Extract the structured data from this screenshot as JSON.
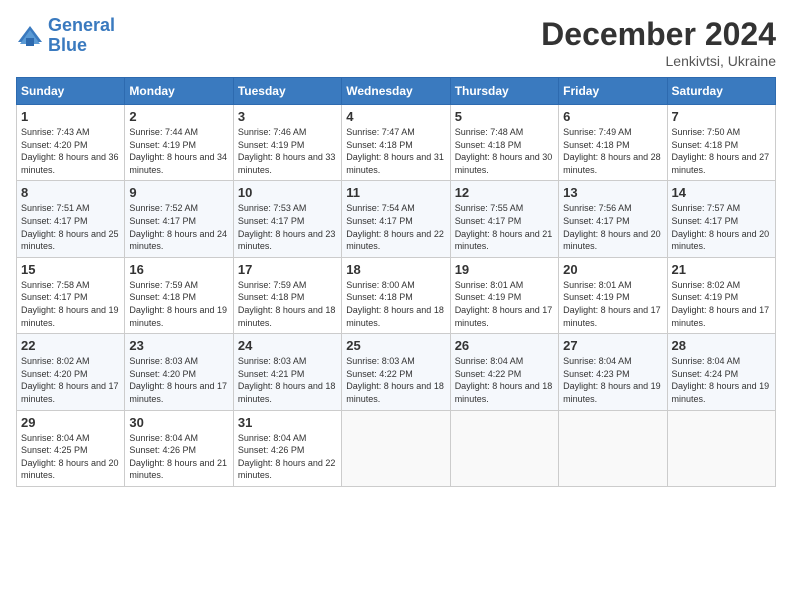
{
  "header": {
    "logo_line1": "General",
    "logo_line2": "Blue",
    "month": "December 2024",
    "location": "Lenkivtsi, Ukraine"
  },
  "days_of_week": [
    "Sunday",
    "Monday",
    "Tuesday",
    "Wednesday",
    "Thursday",
    "Friday",
    "Saturday"
  ],
  "weeks": [
    [
      {
        "num": "1",
        "rise": "7:43 AM",
        "set": "4:20 PM",
        "hours": "8 hours and 36 minutes."
      },
      {
        "num": "2",
        "rise": "7:44 AM",
        "set": "4:19 PM",
        "hours": "8 hours and 34 minutes."
      },
      {
        "num": "3",
        "rise": "7:46 AM",
        "set": "4:19 PM",
        "hours": "8 hours and 33 minutes."
      },
      {
        "num": "4",
        "rise": "7:47 AM",
        "set": "4:18 PM",
        "hours": "8 hours and 31 minutes."
      },
      {
        "num": "5",
        "rise": "7:48 AM",
        "set": "4:18 PM",
        "hours": "8 hours and 30 minutes."
      },
      {
        "num": "6",
        "rise": "7:49 AM",
        "set": "4:18 PM",
        "hours": "8 hours and 28 minutes."
      },
      {
        "num": "7",
        "rise": "7:50 AM",
        "set": "4:18 PM",
        "hours": "8 hours and 27 minutes."
      }
    ],
    [
      {
        "num": "8",
        "rise": "7:51 AM",
        "set": "4:17 PM",
        "hours": "8 hours and 25 minutes."
      },
      {
        "num": "9",
        "rise": "7:52 AM",
        "set": "4:17 PM",
        "hours": "8 hours and 24 minutes."
      },
      {
        "num": "10",
        "rise": "7:53 AM",
        "set": "4:17 PM",
        "hours": "8 hours and 23 minutes."
      },
      {
        "num": "11",
        "rise": "7:54 AM",
        "set": "4:17 PM",
        "hours": "8 hours and 22 minutes."
      },
      {
        "num": "12",
        "rise": "7:55 AM",
        "set": "4:17 PM",
        "hours": "8 hours and 21 minutes."
      },
      {
        "num": "13",
        "rise": "7:56 AM",
        "set": "4:17 PM",
        "hours": "8 hours and 20 minutes."
      },
      {
        "num": "14",
        "rise": "7:57 AM",
        "set": "4:17 PM",
        "hours": "8 hours and 20 minutes."
      }
    ],
    [
      {
        "num": "15",
        "rise": "7:58 AM",
        "set": "4:17 PM",
        "hours": "8 hours and 19 minutes."
      },
      {
        "num": "16",
        "rise": "7:59 AM",
        "set": "4:18 PM",
        "hours": "8 hours and 19 minutes."
      },
      {
        "num": "17",
        "rise": "7:59 AM",
        "set": "4:18 PM",
        "hours": "8 hours and 18 minutes."
      },
      {
        "num": "18",
        "rise": "8:00 AM",
        "set": "4:18 PM",
        "hours": "8 hours and 18 minutes."
      },
      {
        "num": "19",
        "rise": "8:01 AM",
        "set": "4:19 PM",
        "hours": "8 hours and 17 minutes."
      },
      {
        "num": "20",
        "rise": "8:01 AM",
        "set": "4:19 PM",
        "hours": "8 hours and 17 minutes."
      },
      {
        "num": "21",
        "rise": "8:02 AM",
        "set": "4:19 PM",
        "hours": "8 hours and 17 minutes."
      }
    ],
    [
      {
        "num": "22",
        "rise": "8:02 AM",
        "set": "4:20 PM",
        "hours": "8 hours and 17 minutes."
      },
      {
        "num": "23",
        "rise": "8:03 AM",
        "set": "4:20 PM",
        "hours": "8 hours and 17 minutes."
      },
      {
        "num": "24",
        "rise": "8:03 AM",
        "set": "4:21 PM",
        "hours": "8 hours and 18 minutes."
      },
      {
        "num": "25",
        "rise": "8:03 AM",
        "set": "4:22 PM",
        "hours": "8 hours and 18 minutes."
      },
      {
        "num": "26",
        "rise": "8:04 AM",
        "set": "4:22 PM",
        "hours": "8 hours and 18 minutes."
      },
      {
        "num": "27",
        "rise": "8:04 AM",
        "set": "4:23 PM",
        "hours": "8 hours and 19 minutes."
      },
      {
        "num": "28",
        "rise": "8:04 AM",
        "set": "4:24 PM",
        "hours": "8 hours and 19 minutes."
      }
    ],
    [
      {
        "num": "29",
        "rise": "8:04 AM",
        "set": "4:25 PM",
        "hours": "8 hours and 20 minutes."
      },
      {
        "num": "30",
        "rise": "8:04 AM",
        "set": "4:26 PM",
        "hours": "8 hours and 21 minutes."
      },
      {
        "num": "31",
        "rise": "8:04 AM",
        "set": "4:26 PM",
        "hours": "8 hours and 22 minutes."
      },
      null,
      null,
      null,
      null
    ]
  ]
}
